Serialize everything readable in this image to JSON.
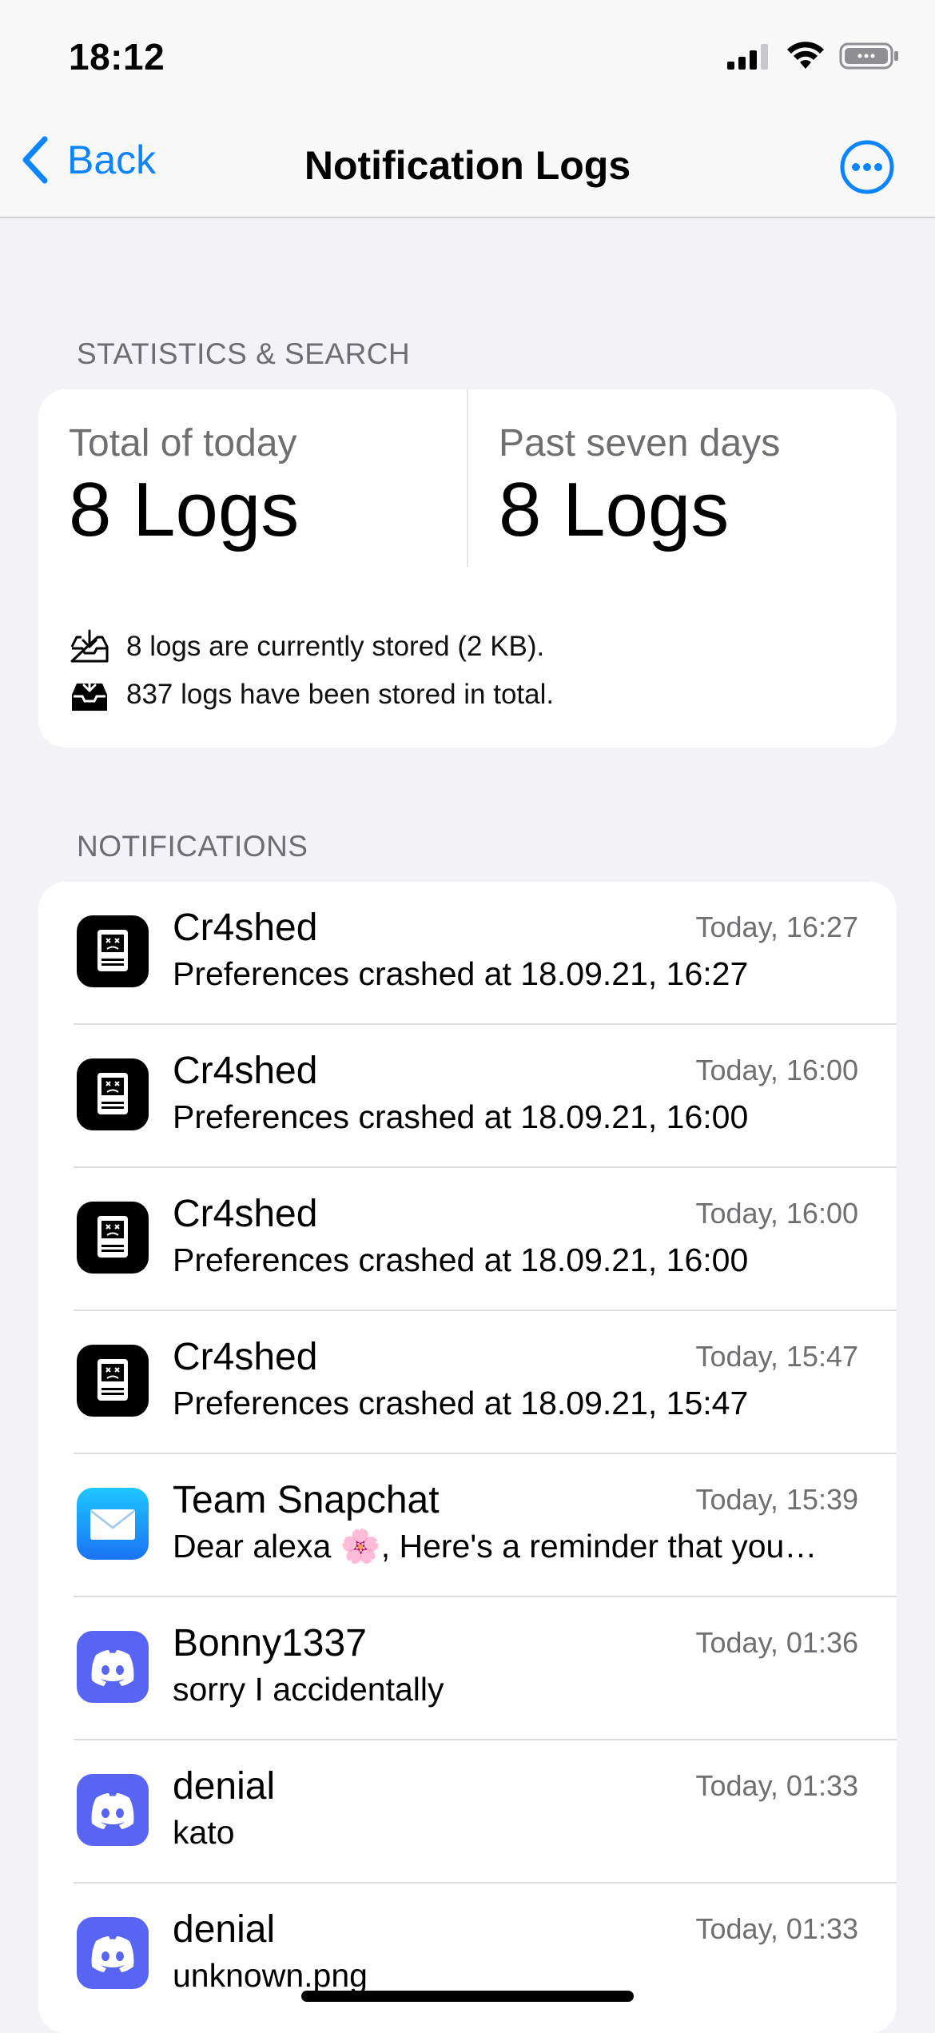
{
  "status_bar": {
    "time": "18:12"
  },
  "nav": {
    "back_label": "Back",
    "title": "Notification Logs"
  },
  "stats_section": {
    "header": "STATISTICS & SEARCH",
    "today_label": "Total of today",
    "today_value": "8 Logs",
    "week_label": "Past seven days",
    "week_value": "8 Logs",
    "stored_text": "8 logs are currently stored (2 KB).",
    "total_text": "837 logs have been stored in total."
  },
  "notifications_section": {
    "header": "NOTIFICATIONS",
    "items": [
      {
        "app": "Cr4shed",
        "time": "Today, 16:27",
        "message": "Preferences crashed at 18.09.21, 16:27",
        "icon": "cr4shed-icon"
      },
      {
        "app": "Cr4shed",
        "time": "Today, 16:00",
        "message": "Preferences crashed at 18.09.21, 16:00",
        "icon": "cr4shed-icon"
      },
      {
        "app": "Cr4shed",
        "time": "Today, 16:00",
        "message": "Preferences crashed at 18.09.21, 16:00",
        "icon": "cr4shed-icon"
      },
      {
        "app": "Cr4shed",
        "time": "Today, 15:47",
        "message": "Preferences crashed at 18.09.21, 15:47",
        "icon": "cr4shed-icon"
      },
      {
        "app": "Team Snapchat",
        "time": "Today, 15:39",
        "message": "Dear alexa 🌸, Here's a reminder that you…",
        "icon": "mail-icon"
      },
      {
        "app": "Bonny1337",
        "time": "Today, 01:36",
        "message": "sorry I accidentally",
        "icon": "discord-icon"
      },
      {
        "app": "denial",
        "time": "Today, 01:33",
        "message": "kato",
        "icon": "discord-icon"
      },
      {
        "app": "denial",
        "time": "Today, 01:33",
        "message": "unknown.png",
        "icon": "discord-icon"
      }
    ]
  },
  "colors": {
    "accent": "#0A84FF",
    "background": "#F2F2F7",
    "discord": "#5865F2"
  }
}
